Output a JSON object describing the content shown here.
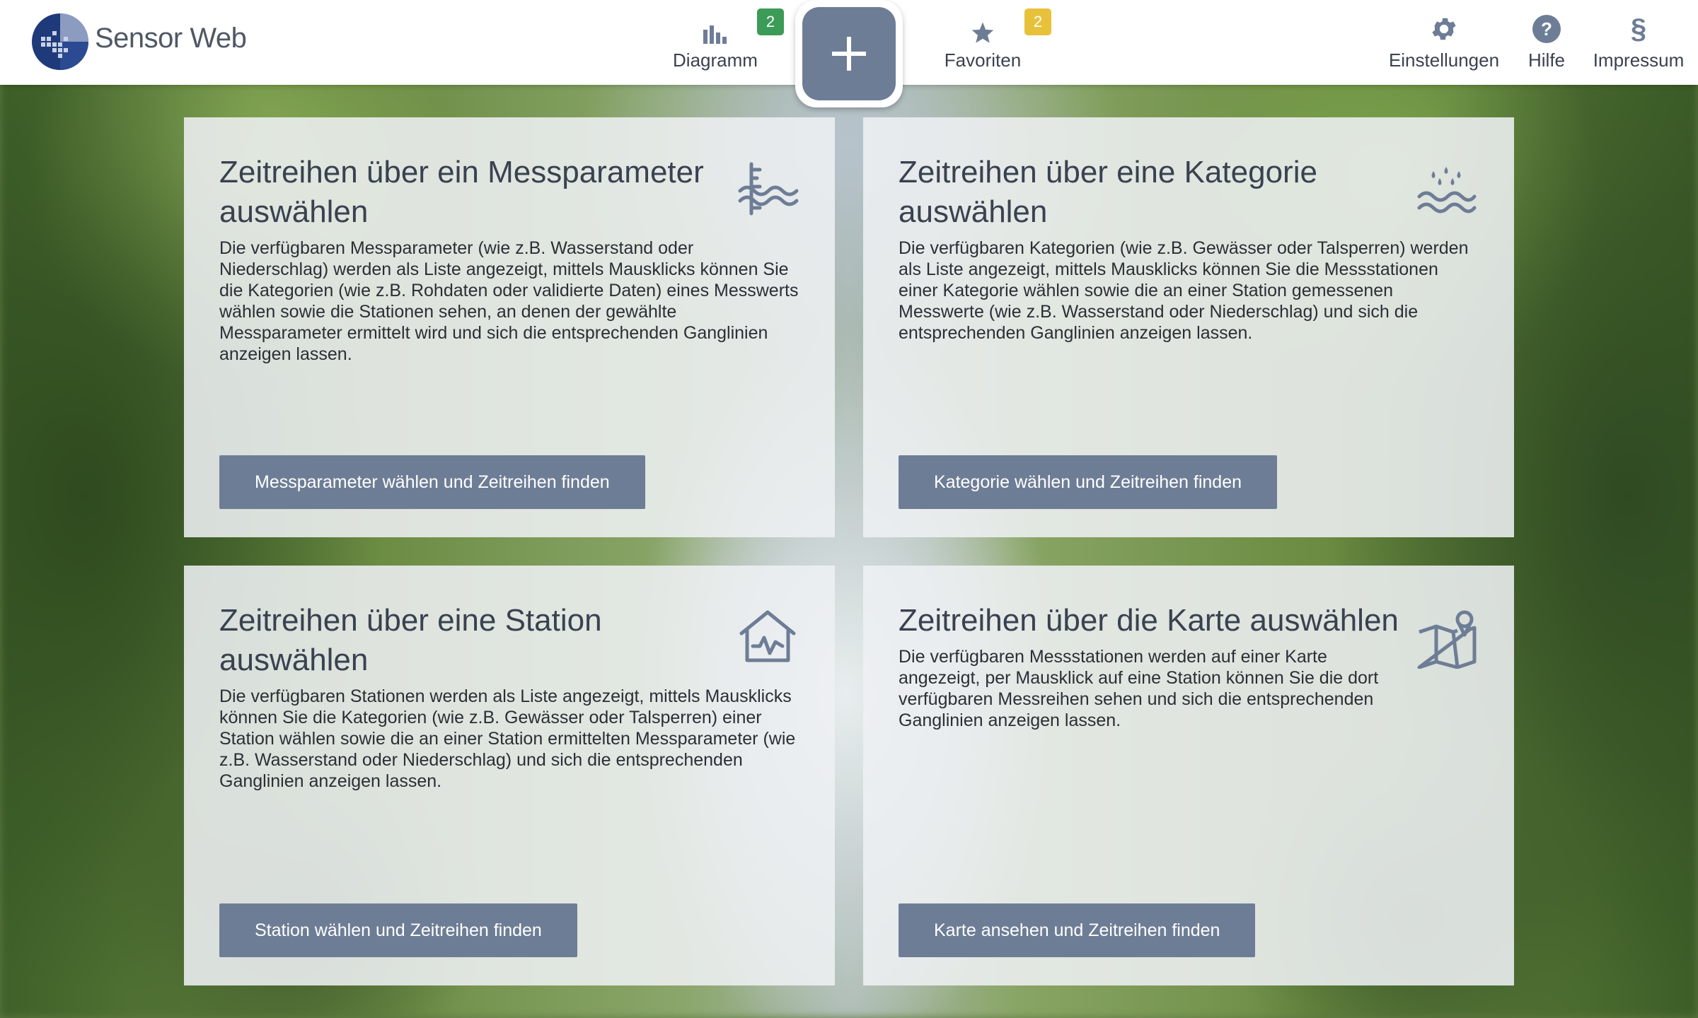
{
  "app": {
    "logo_text": "Sensor Web",
    "logo_icon": "sensorweb-logo-icon"
  },
  "nav": {
    "diagram": {
      "label": "Diagramm",
      "badge": "2",
      "icon": "bar-chart-icon"
    },
    "favorites": {
      "label": "Favoriten",
      "badge": "2",
      "icon": "star-icon"
    },
    "add": {
      "icon": "plus-icon"
    },
    "settings": {
      "label": "Einstellungen",
      "icon": "gear-icon"
    },
    "help": {
      "label": "Hilfe",
      "icon": "help-icon"
    },
    "imprint": {
      "label": "Impressum",
      "icon": "paragraph-icon",
      "glyph": "§"
    }
  },
  "cards": [
    {
      "title": "Zeitreihen über ein Messparameter auswählen",
      "text": "Die verfügbaren Messparameter (wie z.B. Wasserstand oder Niederschlag) werden als Liste angezeigt, mittels Mausklicks können Sie die Kategorien (wie z.B. Rohdaten oder validierte Daten) eines Messwerts wählen sowie die Stationen sehen, an denen der gewählte Messparameter ermittelt wird und sich die entsprechenden Ganglinien anzeigen lassen.",
      "button": "Messparameter wählen und Zeitreihen finden",
      "icon": "water-level-icon"
    },
    {
      "title": "Zeitreihen über eine Kategorie auswählen",
      "text": "Die verfügbaren Kategorien (wie z.B. Gewässer oder Talsperren) werden als Liste angezeigt, mittels Mausklicks können Sie die Messstationen einer Kategorie wählen sowie die an einer Station gemessenen Messwerte (wie z.B. Wasserstand oder Niederschlag) und sich die entsprechenden Ganglinien anzeigen lassen.",
      "button": "Kategorie wählen und Zeitreihen finden",
      "icon": "rain-water-icon"
    },
    {
      "title": "Zeitreihen über eine Station auswählen",
      "text": "Die verfügbaren Stationen werden als Liste angezeigt, mittels Mausklicks können Sie die Kategorien (wie z.B. Gewässer oder Talsperren) einer Station wählen sowie die an einer Station ermittelten Messparameter (wie z.B. Wasserstand oder Niederschlag) und sich die entsprechenden Ganglinien anzeigen lassen.",
      "button": "Station wählen und Zeitreihen finden",
      "icon": "station-house-icon"
    },
    {
      "title": "Zeitreihen über die Karte auswählen",
      "text": "Die verfügbaren Messstationen werden auf einer Karte angezeigt, per Mausklick auf eine Station können Sie die dort verfügbaren Messreihen sehen und sich die entsprechenden Ganglinien anzeigen lassen.",
      "button": "Karte ansehen und Zeitreihen finden",
      "icon": "map-pin-icon"
    }
  ],
  "colors": {
    "accent": "#6e7d96",
    "badge_green": "#3c9b56",
    "badge_yellow": "#e8c13b",
    "text": "#3a4150"
  }
}
